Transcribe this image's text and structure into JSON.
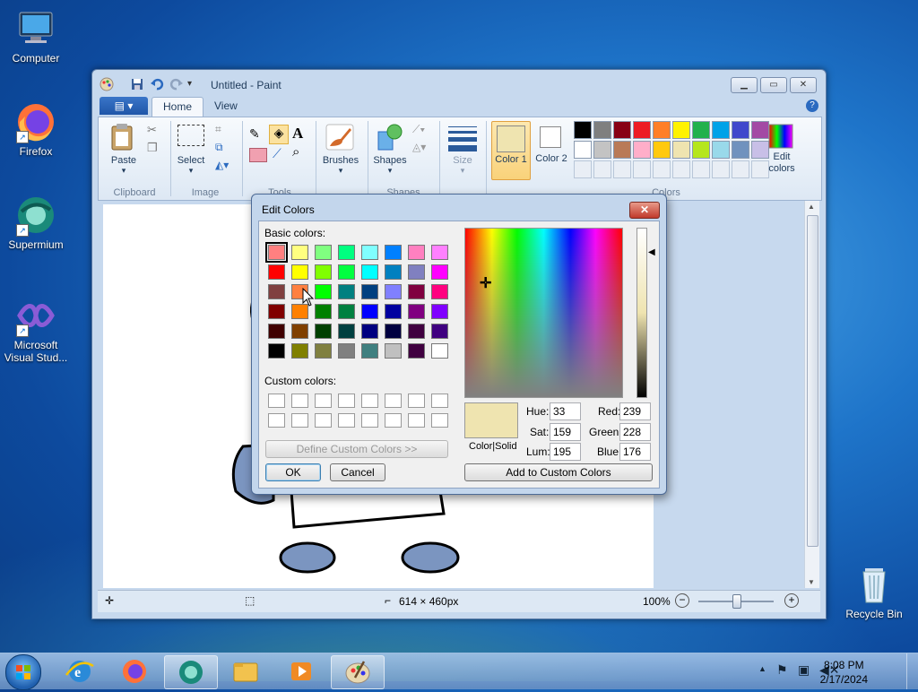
{
  "desktop": {
    "icons": [
      {
        "label": "Computer"
      },
      {
        "label": "Firefox"
      },
      {
        "label": "Supermium"
      },
      {
        "label": "Microsoft Visual Stud..."
      },
      {
        "label": "Recycle Bin"
      }
    ]
  },
  "paint": {
    "title": "Untitled - Paint",
    "tabs": {
      "home": "Home",
      "view": "View"
    },
    "ribbon": {
      "paste": "Paste",
      "select": "Select",
      "brushes": "Brushes",
      "shapes": "Shapes",
      "size": "Size",
      "color1": "Color 1",
      "color2": "Color 2",
      "edit_colors": "Edit colors",
      "groups": {
        "clipboard": "Clipboard",
        "image": "Image",
        "tools": "Tools",
        "shapes": "Shapes",
        "colors": "Colors"
      },
      "palette_row1": [
        "#000000",
        "#7f7f7f",
        "#880015",
        "#ed1c24",
        "#ff7f27",
        "#fff200",
        "#22b14c",
        "#00a2e8",
        "#3f48cc",
        "#a349a4"
      ],
      "palette_row2": [
        "#ffffff",
        "#c3c3c3",
        "#b97a57",
        "#ffaec9",
        "#ffc90e",
        "#efe4b0",
        "#b5e61d",
        "#99d9ea",
        "#7092be",
        "#c8bfe7"
      ]
    },
    "status": {
      "dimensions": "614 × 460px",
      "zoom": "100%"
    }
  },
  "dialog": {
    "title": "Edit Colors",
    "close": "✕",
    "basic_colors_label": "Basic colors:",
    "custom_colors_label": "Custom colors:",
    "define_custom": "Define Custom Colors >>",
    "ok": "OK",
    "cancel": "Cancel",
    "add_custom": "Add to Custom Colors",
    "color_solid": "Color|Solid",
    "hue_label": "Hue:",
    "sat_label": "Sat:",
    "lum_label": "Lum:",
    "red_label": "Red:",
    "green_label": "Green:",
    "blue_label": "Blue:",
    "hue": "33",
    "sat": "159",
    "lum": "195",
    "red": "239",
    "green": "228",
    "blue": "176",
    "preview_color": "#efe4b0",
    "basic_colors": [
      [
        "#ff8080",
        "#ffff80",
        "#80ff80",
        "#00ff80",
        "#80ffff",
        "#0080ff",
        "#ff80c0",
        "#ff80ff"
      ],
      [
        "#ff0000",
        "#ffff00",
        "#80ff00",
        "#00ff40",
        "#00ffff",
        "#0080c0",
        "#8080c0",
        "#ff00ff"
      ],
      [
        "#804040",
        "#ff8040",
        "#00ff00",
        "#008080",
        "#004080",
        "#8080ff",
        "#800040",
        "#ff0080"
      ],
      [
        "#800000",
        "#ff8000",
        "#008000",
        "#008040",
        "#0000ff",
        "#0000a0",
        "#800080",
        "#8000ff"
      ],
      [
        "#400000",
        "#804000",
        "#004000",
        "#004040",
        "#000080",
        "#000040",
        "#400040",
        "#400080"
      ],
      [
        "#000000",
        "#808000",
        "#808040",
        "#808080",
        "#408080",
        "#c0c0c0",
        "#400040",
        "#ffffff"
      ]
    ]
  },
  "taskbar": {
    "time": "8:08 PM",
    "date": "2/17/2024"
  }
}
